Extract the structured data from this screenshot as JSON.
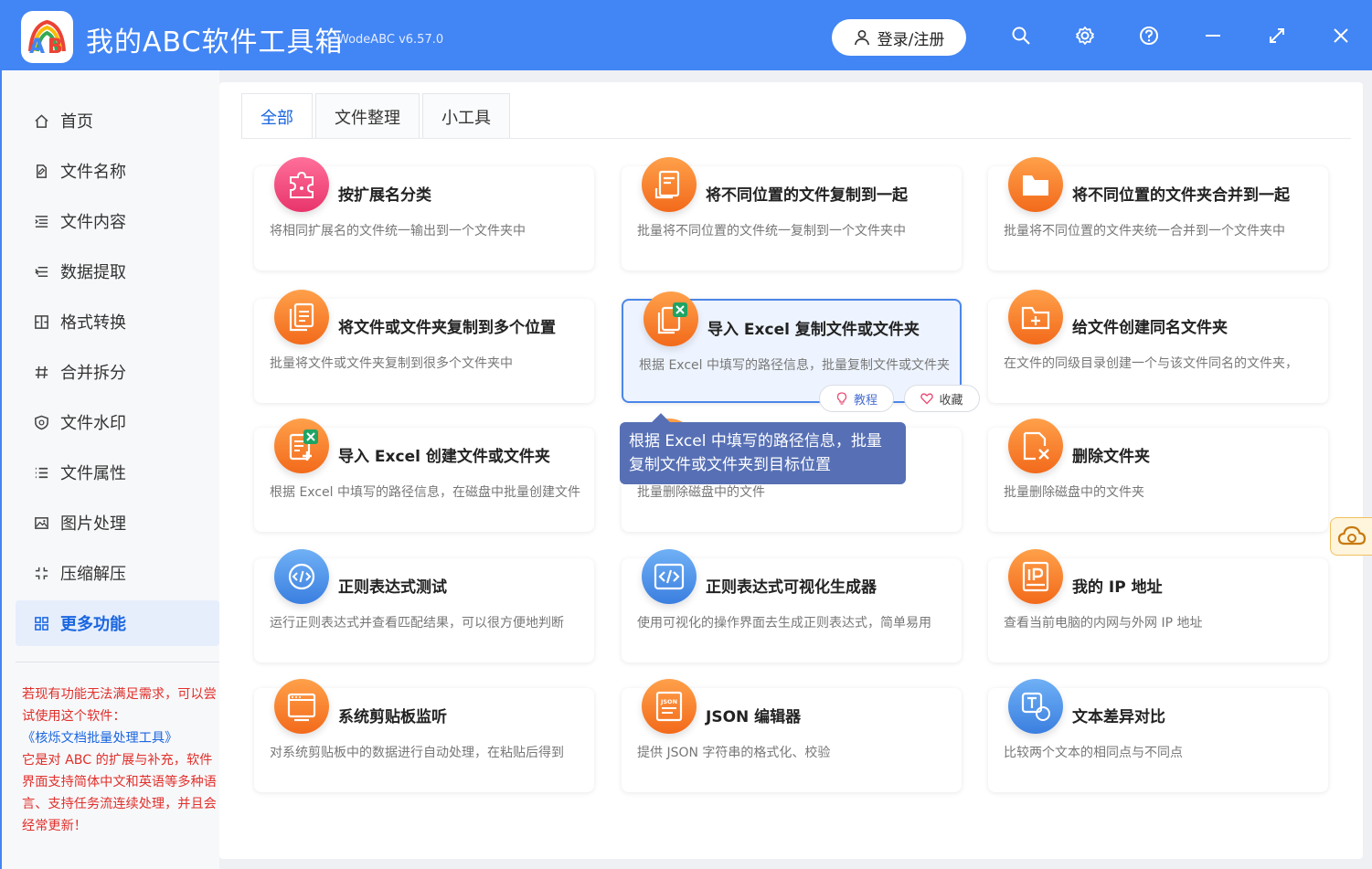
{
  "app": {
    "title": "我的ABC软件工具箱",
    "version": "WodeABC v6.57.0",
    "login_label": "登录/注册",
    "brand_color": "#4285f4",
    "window_icons": [
      "search-icon",
      "settings-icon",
      "help-icon",
      "minimize-icon",
      "maximize-icon",
      "close-icon"
    ]
  },
  "sidebar": {
    "items": [
      {
        "label": "首页",
        "icon": "home-icon"
      },
      {
        "label": "文件名称",
        "icon": "file-name-icon"
      },
      {
        "label": "文件内容",
        "icon": "file-content-icon"
      },
      {
        "label": "数据提取",
        "icon": "data-extract-icon"
      },
      {
        "label": "格式转换",
        "icon": "format-convert-icon"
      },
      {
        "label": "合并拆分",
        "icon": "merge-split-icon"
      },
      {
        "label": "文件水印",
        "icon": "watermark-icon"
      },
      {
        "label": "文件属性",
        "icon": "file-attr-icon"
      },
      {
        "label": "图片处理",
        "icon": "image-icon"
      },
      {
        "label": "压缩解压",
        "icon": "compress-icon"
      },
      {
        "label": "更多功能",
        "icon": "more-icon",
        "active": true
      }
    ],
    "note": {
      "line1": "若现有功能无法满足需求，可以尝试使用这个软件：",
      "link": "《核烁文档批量处理工具》",
      "line2": "它是对 ABC 的扩展与补充，软件界面支持简体中文和英语等多种语言、支持任务流连续处理，并且会经常更新！"
    }
  },
  "tabs": [
    {
      "label": "全部",
      "active": true
    },
    {
      "label": "文件整理"
    },
    {
      "label": "小工具"
    }
  ],
  "cards": [
    {
      "title": "按扩展名分类",
      "desc": "将相同扩展名的文件统一输出到一个文件夹中",
      "icon": "puzzle-icon",
      "color": "#f0457a"
    },
    {
      "title": "将不同位置的文件复制到一起",
      "desc": "批量将不同位置的文件统一复制到一个文件夹中",
      "icon": "file-copy-icon",
      "color": "#f5792a"
    },
    {
      "title": "将不同位置的文件夹合并到一起",
      "desc": "批量将不同位置的文件夹统一合并到一个文件夹中",
      "icon": "folder-icon",
      "color": "#f5792a"
    },
    {
      "title": "将文件或文件夹复制到多个位置",
      "desc": "批量将文件或文件夹复制到很多个文件夹中",
      "icon": "multi-copy-icon",
      "color": "#f5792a"
    },
    {
      "title": "导入 Excel 复制文件或文件夹",
      "desc": "根据 Excel 中填写的路径信息，批量复制文件或文件夹",
      "icon": "excel-copy-icon",
      "color": "#f5792a"
    },
    {
      "title": "给文件创建同名文件夹",
      "desc": "在文件的同级目录创建一个与该文件同名的文件夹，",
      "icon": "folder-add-icon",
      "color": "#f5792a"
    },
    {
      "title": "导入 Excel 创建文件或文件夹",
      "desc": "根据 Excel 中填写的路径信息，在磁盘中批量创建文件",
      "icon": "excel-create-icon",
      "color": "#f5792a"
    },
    {
      "title": "",
      "desc": "批量删除磁盘中的文件",
      "icon": "file-delete-icon",
      "color": "#f5792a"
    },
    {
      "title": "删除文件夹",
      "desc": "批量删除磁盘中的文件夹",
      "icon": "folder-delete-icon",
      "color": "#f5792a"
    },
    {
      "title": "正则表达式测试",
      "desc": "运行正则表达式并查看匹配结果，可以很方便地判断",
      "icon": "regex-test-icon",
      "color": "#4a90e8"
    },
    {
      "title": "正则表达式可视化生成器",
      "desc": "使用可视化的操作界面去生成正则表达式，简单易用",
      "icon": "code-icon",
      "color": "#4a90e8"
    },
    {
      "title": "我的 IP 地址",
      "desc": "查看当前电脑的内网与外网 IP 地址",
      "icon": "ip-icon",
      "color": "#f5792a"
    },
    {
      "title": "系统剪贴板监听",
      "desc": "对系统剪贴板中的数据进行自动处理，在粘贴后得到",
      "icon": "clipboard-icon",
      "color": "#f5792a"
    },
    {
      "title": "JSON 编辑器",
      "desc": "提供 JSON 字符串的格式化、校验",
      "icon": "json-icon",
      "color": "#f5792a"
    },
    {
      "title": "文本差异对比",
      "desc": "比较两个文本的相同点与不同点",
      "icon": "text-diff-icon",
      "color": "#4a90e8"
    }
  ],
  "hover_actions": {
    "tutorial": "教程",
    "favorite": "收藏"
  },
  "tooltip": "根据 Excel 中填写的路径信息，批量复制文件或文件夹到目标位置"
}
